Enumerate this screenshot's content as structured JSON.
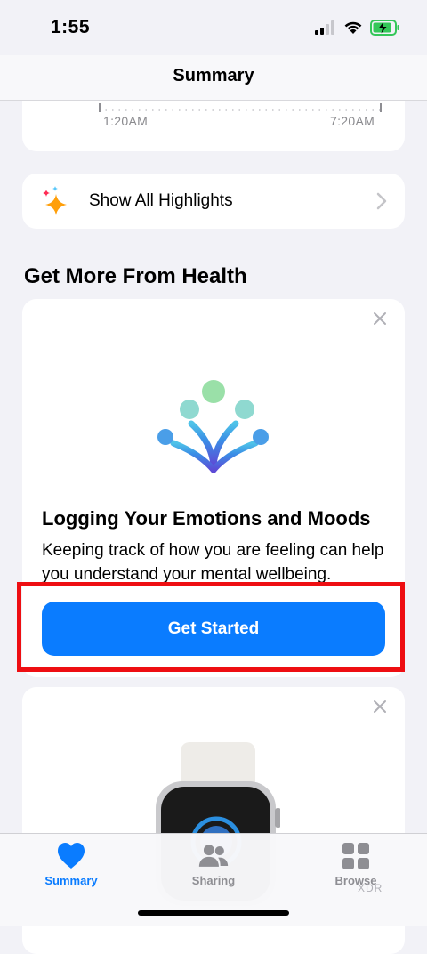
{
  "status_bar": {
    "time": "1:55"
  },
  "nav": {
    "title": "Summary"
  },
  "timeline": {
    "start_label": "1:20AM",
    "end_label": "7:20AM"
  },
  "highlights": {
    "label": "Show All Highlights"
  },
  "section": {
    "title": "Get More From Health"
  },
  "promo": {
    "title": "Logging Your Emotions and Moods",
    "body": "Keeping track of how you are feeling can help you understand your mental wellbeing.",
    "cta_label": "Get Started"
  },
  "tabs": [
    {
      "label": "Summary",
      "icon": "heart-icon",
      "active": true
    },
    {
      "label": "Sharing",
      "icon": "people-icon",
      "active": false
    },
    {
      "label": "Browse",
      "icon": "grid-icon",
      "active": false
    }
  ],
  "watermark": "XDR",
  "colors": {
    "accent": "#0a7cff",
    "highlight_box": "#ee0e12",
    "battery": "#34c759"
  }
}
